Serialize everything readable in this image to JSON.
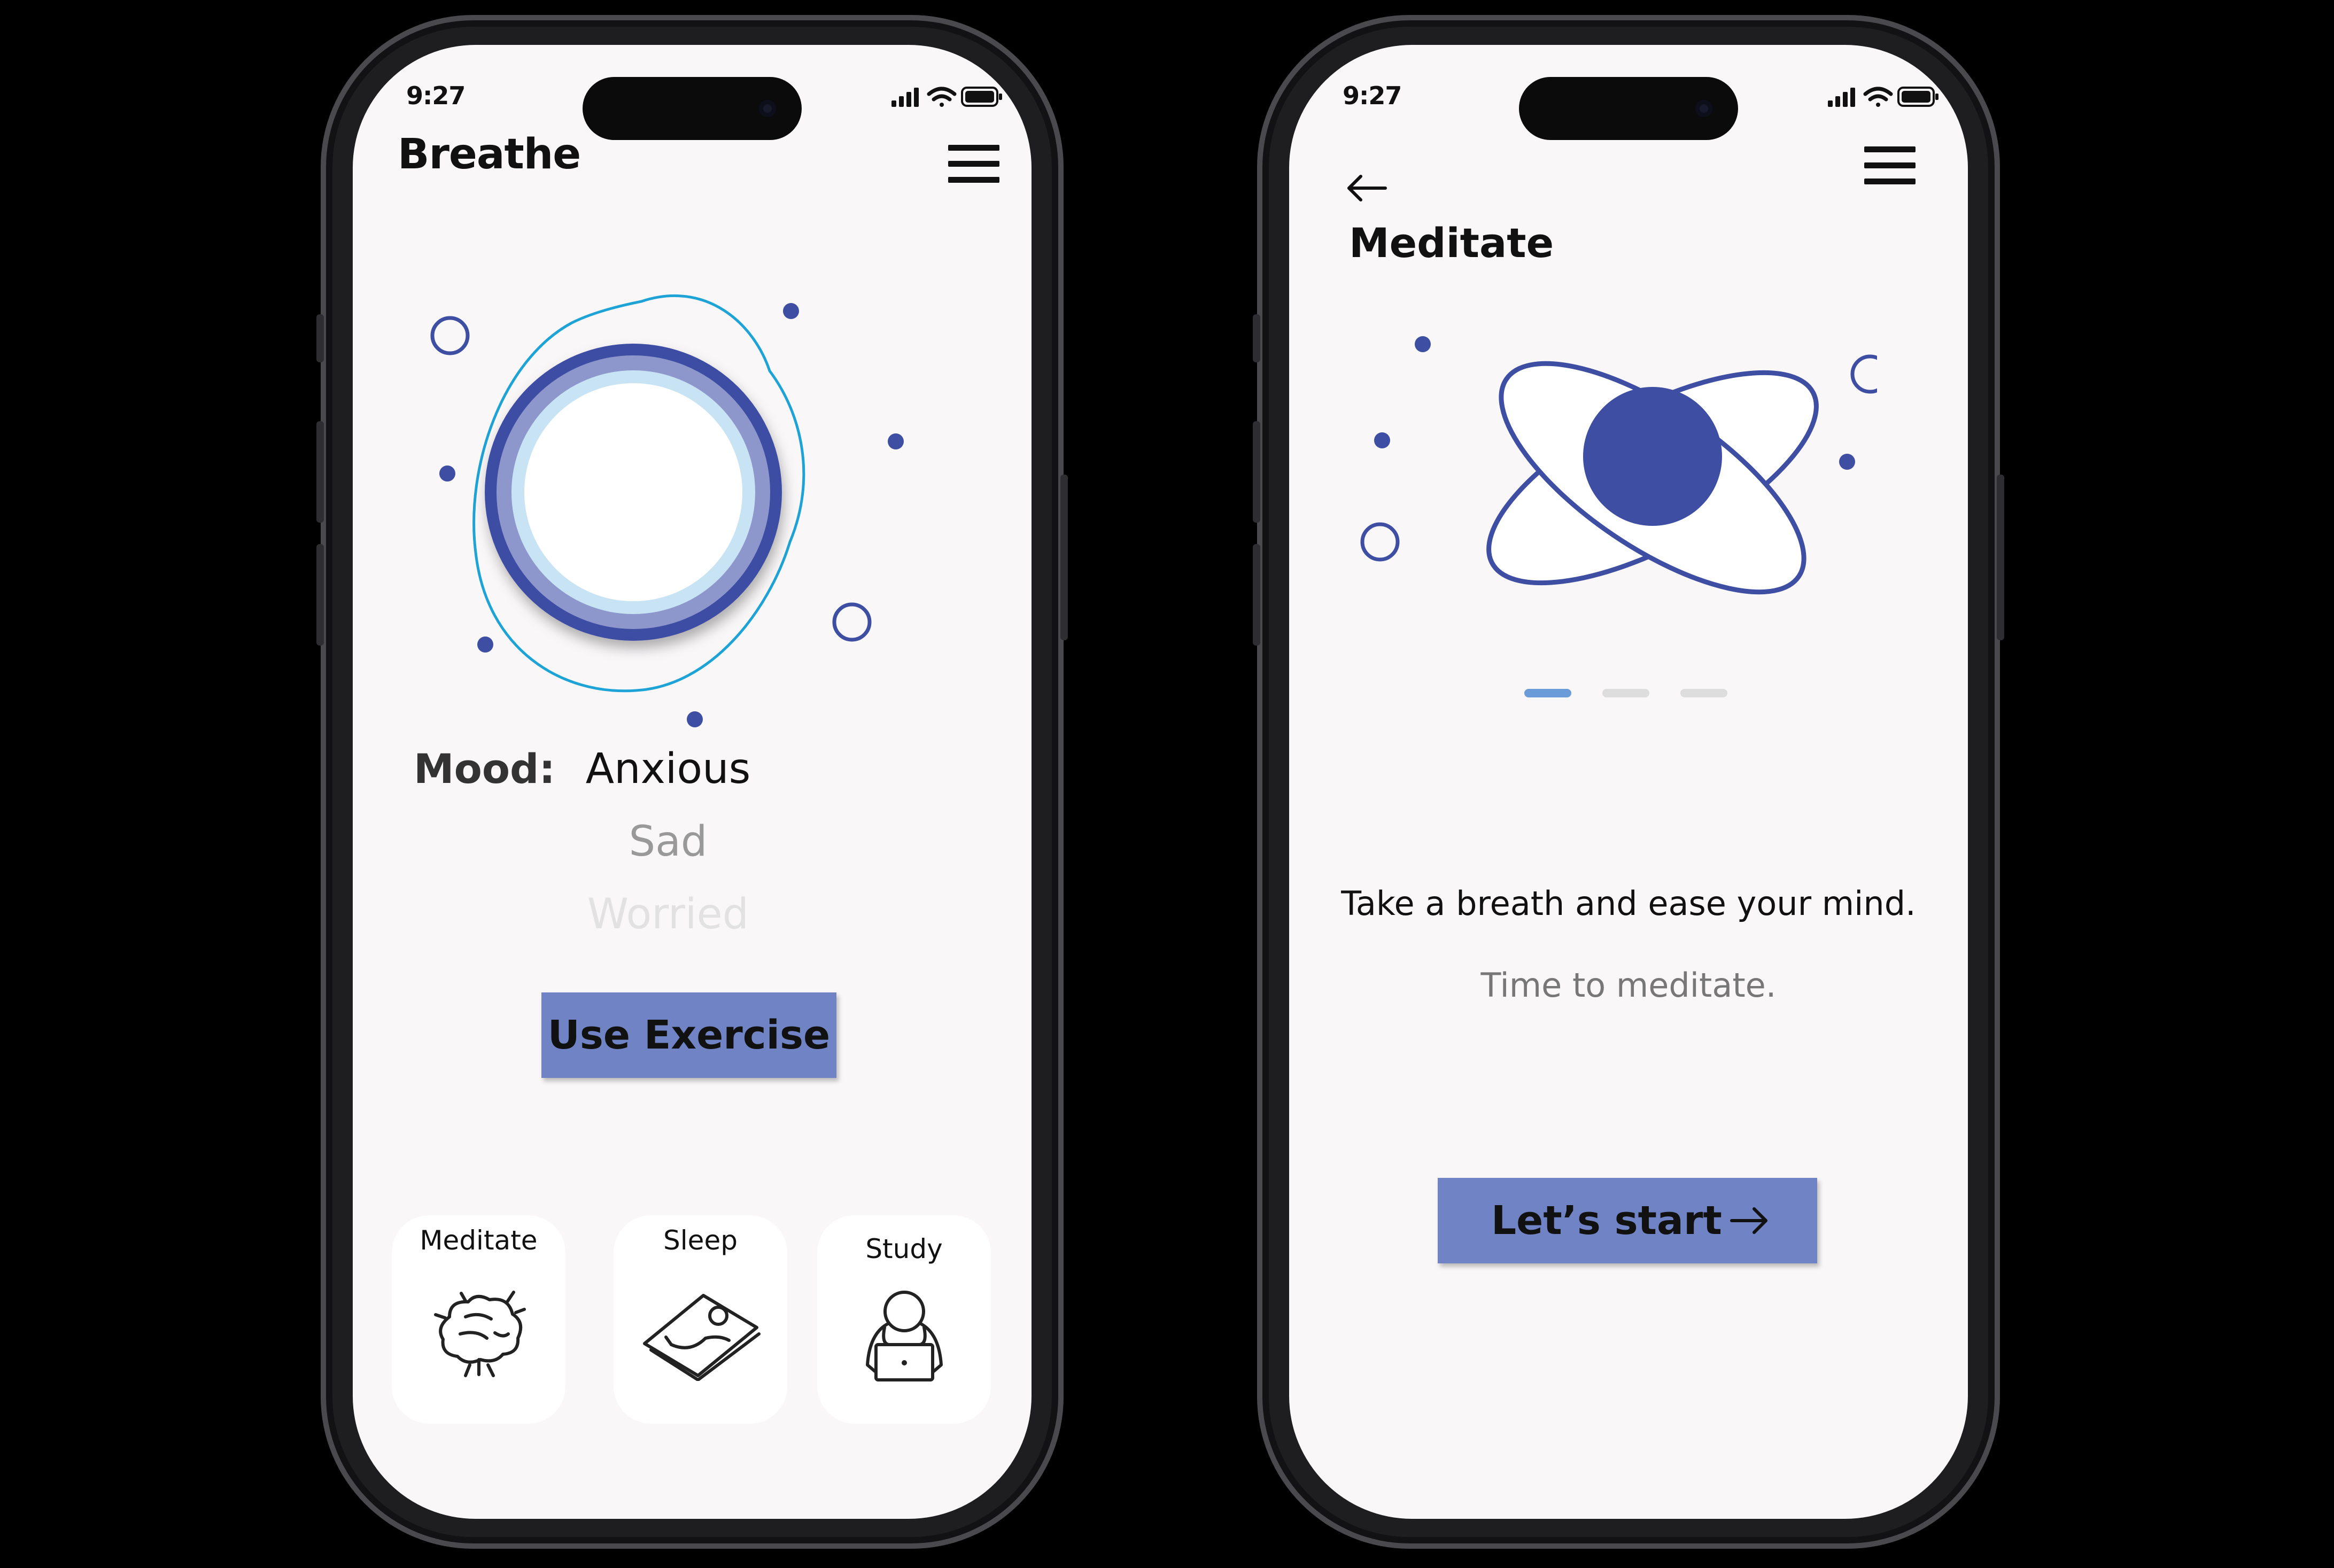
{
  "colors": {
    "accent": "#3d4ea3",
    "button": "#7083c4",
    "ring_light": "#c8e4f4",
    "ring_mid": "#8e97cc",
    "outline": "#1ea3d6",
    "screen_bg": "#f9f7f8",
    "indicator_active": "#6c9bd9",
    "indicator_inactive": "#dddddd"
  },
  "left_screen": {
    "status": {
      "time": "9:27",
      "icons": [
        "signal-icon",
        "wifi-icon",
        "battery-icon"
      ]
    },
    "header": {
      "title": "Breathe",
      "menu_icon": "hamburger-menu-icon"
    },
    "mood": {
      "label": "Mood:",
      "options": [
        {
          "label": "Anxious",
          "state": "selected",
          "color": "#111111"
        },
        {
          "label": "Sad",
          "state": "faded",
          "color": "#999999"
        },
        {
          "label": "Worried",
          "state": "faded",
          "color": "#e2e2e2"
        }
      ]
    },
    "action": {
      "label": "Use Exercise"
    },
    "categories": [
      {
        "label": "Meditate",
        "icon": "brain-icon"
      },
      {
        "label": "Sleep",
        "icon": "sleeping-person-icon"
      },
      {
        "label": "Study",
        "icon": "person-laptop-icon"
      }
    ]
  },
  "right_screen": {
    "status": {
      "time": "9:27",
      "icons": [
        "signal-icon",
        "wifi-icon",
        "battery-icon"
      ]
    },
    "header": {
      "back_icon": "back-arrow-icon",
      "menu_icon": "hamburger-menu-icon"
    },
    "title": "Meditate",
    "illustration": "orbit-planet-illustration",
    "pager": {
      "count": 3,
      "active_index": 0
    },
    "tagline": "Take a breath and ease your mind.",
    "subline": "Time to meditate.",
    "action": {
      "label": "Let’s start",
      "icon": "arrow-right-icon"
    }
  }
}
